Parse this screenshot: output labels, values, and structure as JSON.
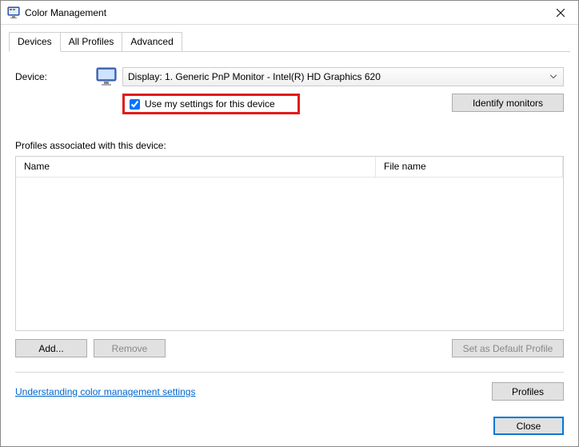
{
  "title": "Color Management",
  "tabs": {
    "devices": "Devices",
    "all_profiles": "All Profiles",
    "advanced": "Advanced"
  },
  "device": {
    "label": "Device:",
    "selected": "Display: 1. Generic PnP Monitor - Intel(R) HD Graphics 620"
  },
  "checkbox": {
    "label": "Use my settings for this device"
  },
  "buttons": {
    "identify": "Identify monitors",
    "add": "Add...",
    "remove": "Remove",
    "set_default": "Set as Default Profile",
    "profiles": "Profiles",
    "close": "Close"
  },
  "profiles": {
    "label": "Profiles associated with this device:",
    "col_name": "Name",
    "col_file": "File name"
  },
  "link": "Understanding color management settings"
}
